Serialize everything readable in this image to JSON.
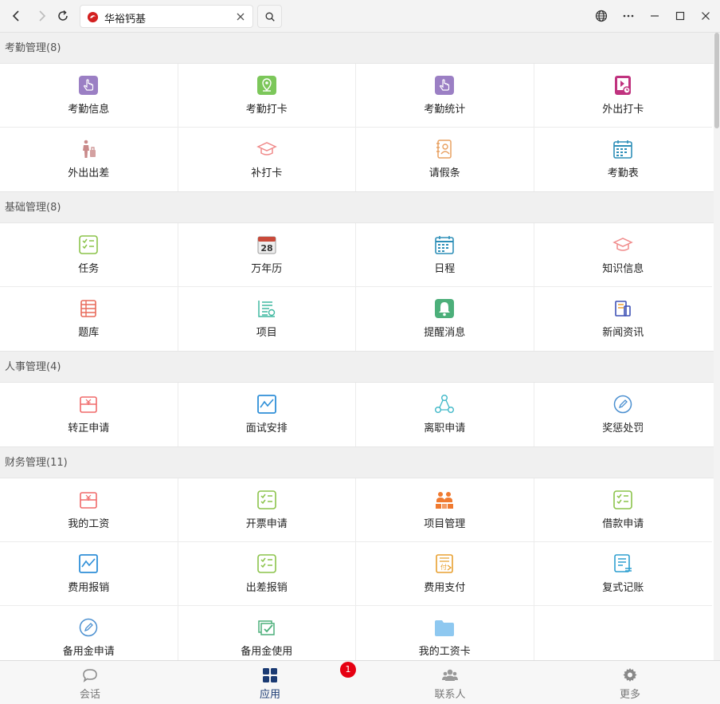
{
  "browser": {
    "tab_title": "华裕钙基"
  },
  "sections": [
    {
      "title": "考勤管理",
      "count": "(8)",
      "items": [
        {
          "label": "考勤信息",
          "icon": "hand-touch-icon",
          "color": "#9b7fc4"
        },
        {
          "label": "考勤打卡",
          "icon": "location-pin-icon",
          "color": "#7cc75a"
        },
        {
          "label": "考勤统计",
          "icon": "hand-touch-icon",
          "color": "#9b7fc4"
        },
        {
          "label": "外出打卡",
          "icon": "phone-clock-icon",
          "color": "#c0337f"
        },
        {
          "label": "外出出差",
          "icon": "traveler-icon",
          "color": "#c98a8a"
        },
        {
          "label": "补打卡",
          "icon": "graduation-cap-icon",
          "color": "#f08a8a"
        },
        {
          "label": "请假条",
          "icon": "id-card-icon",
          "color": "#e8a060"
        },
        {
          "label": "考勤表",
          "icon": "calendar-icon",
          "color": "#2e8fb8"
        }
      ]
    },
    {
      "title": "基础管理",
      "count": "(8)",
      "items": [
        {
          "label": "任务",
          "icon": "checklist-icon",
          "color": "#8bc34a"
        },
        {
          "label": "万年历",
          "icon": "date-28-icon",
          "color": "#c94a3a"
        },
        {
          "label": "日程",
          "icon": "calendar-icon",
          "color": "#2e8fb8"
        },
        {
          "label": "知识信息",
          "icon": "graduation-cap-icon",
          "color": "#f08a8a"
        },
        {
          "label": "题库",
          "icon": "question-bank-icon",
          "color": "#e86a5a"
        },
        {
          "label": "项目",
          "icon": "document-lines-icon",
          "color": "#3fb8a0"
        },
        {
          "label": "提醒消息",
          "icon": "bell-icon",
          "color": "#4caf7a"
        },
        {
          "label": "新闻资讯",
          "icon": "news-icon",
          "color": "#3f51b5"
        }
      ]
    },
    {
      "title": "人事管理",
      "count": "(4)",
      "items": [
        {
          "label": "转正申请",
          "icon": "money-box-icon",
          "color": "#f06a6a"
        },
        {
          "label": "面试安排",
          "icon": "chart-line-icon",
          "color": "#2e8fd8"
        },
        {
          "label": "离职申请",
          "icon": "network-icon",
          "color": "#3fb8c8"
        },
        {
          "label": "奖惩处罚",
          "icon": "pencil-circle-icon",
          "color": "#4a8fd0"
        }
      ]
    },
    {
      "title": "财务管理",
      "count": "(11)",
      "items": [
        {
          "label": "我的工资",
          "icon": "money-box-icon",
          "color": "#f06a6a"
        },
        {
          "label": "开票申请",
          "icon": "checklist-icon",
          "color": "#8bc34a"
        },
        {
          "label": "项目管理",
          "icon": "team-icon",
          "color": "#f07a30"
        },
        {
          "label": "借款申请",
          "icon": "checklist-icon",
          "color": "#8bc34a"
        },
        {
          "label": "费用报销",
          "icon": "chart-line-icon",
          "color": "#2e8fd8"
        },
        {
          "label": "出差报销",
          "icon": "checklist-icon",
          "color": "#8bc34a"
        },
        {
          "label": "费用支付",
          "icon": "payment-doc-icon",
          "color": "#e8a030"
        },
        {
          "label": "复式记账",
          "icon": "ledger-icon",
          "color": "#2e9fd0"
        },
        {
          "label": "备用金申请",
          "icon": "pencil-circle-icon",
          "color": "#4a8fd0"
        },
        {
          "label": "备用金使用",
          "icon": "check-stack-icon",
          "color": "#4caf7a"
        },
        {
          "label": "我的工资卡",
          "icon": "folder-icon",
          "color": "#8ec8f0"
        }
      ]
    }
  ],
  "tabbar": {
    "items": [
      {
        "label": "会话",
        "icon": "chat-bubble-icon"
      },
      {
        "label": "应用",
        "icon": "apps-grid-icon"
      },
      {
        "label": "联系人",
        "icon": "contacts-icon"
      },
      {
        "label": "更多",
        "icon": "gear-icon"
      }
    ],
    "badge": "1"
  },
  "colors": {
    "active_tab": "#1a3a73",
    "badge": "#e60012"
  }
}
